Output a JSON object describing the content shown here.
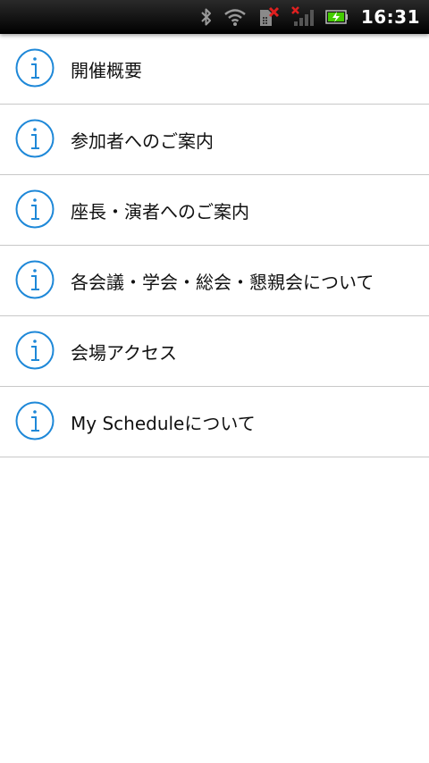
{
  "status_bar": {
    "time": "16:31",
    "icons": [
      "bluetooth-icon",
      "wifi-icon",
      "sim-error-icon",
      "signal-no-service-icon",
      "battery-charging-icon"
    ],
    "icon_color": "#9a9a9a",
    "battery_color": "#44cc00",
    "error_color": "#e02020"
  },
  "menu": {
    "accent_color": "#1e88d8",
    "items": [
      {
        "label": "開催概要"
      },
      {
        "label": "参加者へのご案内"
      },
      {
        "label": "座長・演者へのご案内"
      },
      {
        "label": "各会議・学会・総会・懇親会について"
      },
      {
        "label": "会場アクセス"
      },
      {
        "label": "My Scheduleについて"
      }
    ]
  }
}
